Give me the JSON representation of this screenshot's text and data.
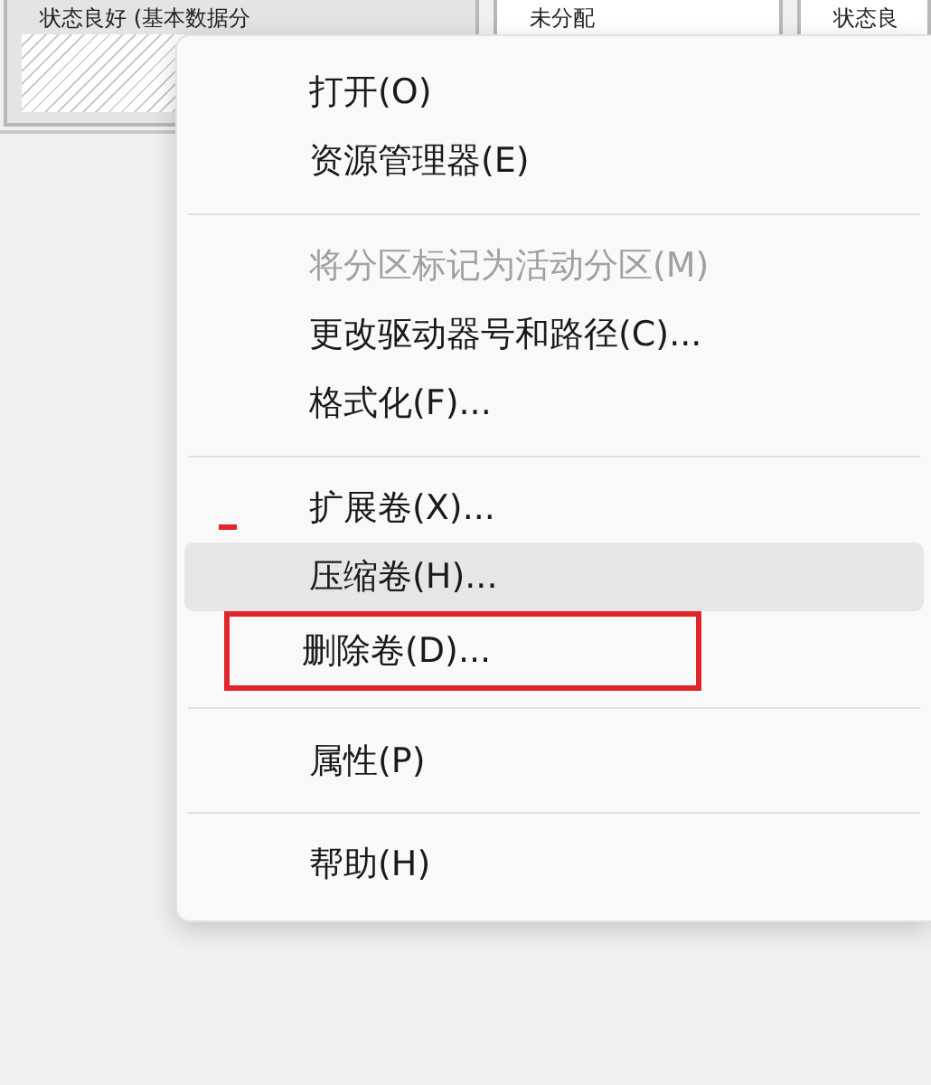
{
  "partitions": [
    {
      "status": "状态良好 (基本数据分"
    },
    {
      "status": "未分配"
    },
    {
      "status": "状态良"
    }
  ],
  "context_menu": {
    "items": [
      {
        "kind": "item",
        "label": "打开(O)",
        "disabled": false,
        "selected": false,
        "marked": false
      },
      {
        "kind": "item",
        "label": "资源管理器(E)",
        "disabled": false,
        "selected": false,
        "marked": false
      },
      {
        "kind": "separator"
      },
      {
        "kind": "item",
        "label": "将分区标记为活动分区(M)",
        "disabled": true,
        "selected": false,
        "marked": false
      },
      {
        "kind": "item",
        "label": "更改驱动器号和路径(C)...",
        "disabled": false,
        "selected": false,
        "marked": false
      },
      {
        "kind": "item",
        "label": "格式化(F)...",
        "disabled": false,
        "selected": false,
        "marked": false
      },
      {
        "kind": "separator"
      },
      {
        "kind": "item",
        "label": "扩展卷(X)...",
        "disabled": false,
        "selected": false,
        "marked": false
      },
      {
        "kind": "item",
        "label": "压缩卷(H)...",
        "disabled": false,
        "selected": true,
        "marked": false
      },
      {
        "kind": "item",
        "label": "删除卷(D)...",
        "disabled": false,
        "selected": false,
        "marked": true
      },
      {
        "kind": "separator"
      },
      {
        "kind": "item",
        "label": "属性(P)",
        "disabled": false,
        "selected": false,
        "marked": false
      },
      {
        "kind": "separator"
      },
      {
        "kind": "item",
        "label": "帮助(H)",
        "disabled": false,
        "selected": false,
        "marked": false
      }
    ]
  }
}
